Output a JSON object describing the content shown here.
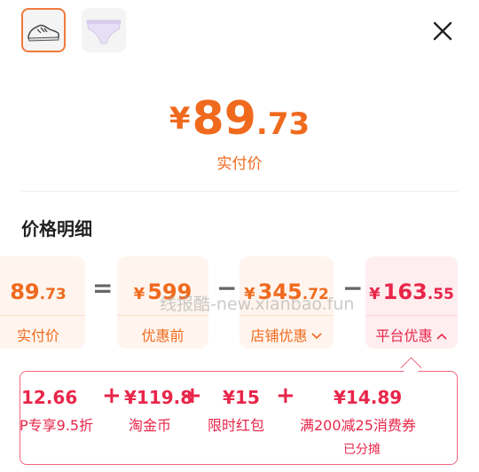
{
  "thumbnails": [
    {
      "icon": "sneaker-icon",
      "selected": true
    },
    {
      "icon": "underwear-icon",
      "selected": false
    }
  ],
  "close_icon": "close-icon",
  "actual_price": {
    "symbol": "¥",
    "integer": "89",
    "decimal": ".73",
    "label": "实付价"
  },
  "section_title": "价格明细",
  "breakdown": {
    "actual": {
      "symbol": "¥",
      "integer": "89",
      "decimal": ".73",
      "label": "实付价"
    },
    "op_equal": "=",
    "original": {
      "symbol": "¥",
      "integer": "599",
      "decimal": "",
      "label": "优惠前"
    },
    "op_minus_1": "−",
    "store": {
      "symbol": "¥",
      "integer": "345",
      "decimal": ".72",
      "label": "店铺优惠"
    },
    "op_minus_2": "−",
    "platform": {
      "symbol": "¥",
      "integer": "163",
      "decimal": ".55",
      "label": "平台优惠"
    }
  },
  "platform_details": [
    {
      "value": "12.66",
      "label": "P专享9.5折"
    },
    {
      "value": "¥119.8",
      "label": "淘金币"
    },
    {
      "value": "¥15",
      "label": "限时红包"
    },
    {
      "value": "¥14.89",
      "label": "满200减25消费券",
      "sub": "已分摊"
    }
  ],
  "plus": "+",
  "watermark": "线报酷-new.xianbao.fun",
  "colors": {
    "orange": "#f06a1e",
    "red": "#e8264a"
  }
}
